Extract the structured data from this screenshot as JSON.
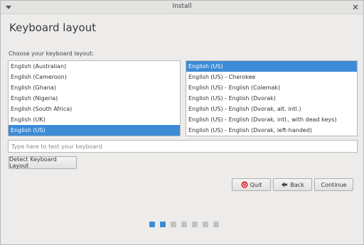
{
  "window": {
    "title": "Install"
  },
  "page": {
    "heading": "Keyboard layout",
    "prompt": "Choose your keyboard layout:"
  },
  "layouts": {
    "items": [
      {
        "label": "English (Australian)",
        "selected": false
      },
      {
        "label": "English (Cameroon)",
        "selected": false
      },
      {
        "label": "English (Ghana)",
        "selected": false
      },
      {
        "label": "English (Nigeria)",
        "selected": false
      },
      {
        "label": "English (South Africa)",
        "selected": false
      },
      {
        "label": "English (UK)",
        "selected": false
      },
      {
        "label": "English (US)",
        "selected": true
      }
    ]
  },
  "variants": {
    "items": [
      {
        "label": "English (US)",
        "selected": true
      },
      {
        "label": "English (US) - Cherokee",
        "selected": false
      },
      {
        "label": "English (US) - English (Colemak)",
        "selected": false
      },
      {
        "label": "English (US) - English (Dvorak)",
        "selected": false
      },
      {
        "label": "English (US) - English (Dvorak, alt. intl.)",
        "selected": false
      },
      {
        "label": "English (US) - English (Dvorak, intl., with dead keys)",
        "selected": false
      },
      {
        "label": "English (US) - English (Dvorak, left-handed)",
        "selected": false
      }
    ]
  },
  "test_field": {
    "placeholder": "Type here to test your keyboard",
    "value": ""
  },
  "buttons": {
    "detect": "Detect Keyboard Layout",
    "quit": "Quit",
    "back": "Back",
    "continue": "Continue"
  },
  "progress": {
    "total_steps": 7,
    "current_step": 2
  },
  "colors": {
    "accent": "#3d8bd6",
    "quit_icon": "#d9262b",
    "background": "#edeceb"
  },
  "icons": {
    "menu": "triangle-down-icon",
    "close": "close-icon",
    "quit": "power-icon",
    "back": "arrow-left-icon"
  }
}
